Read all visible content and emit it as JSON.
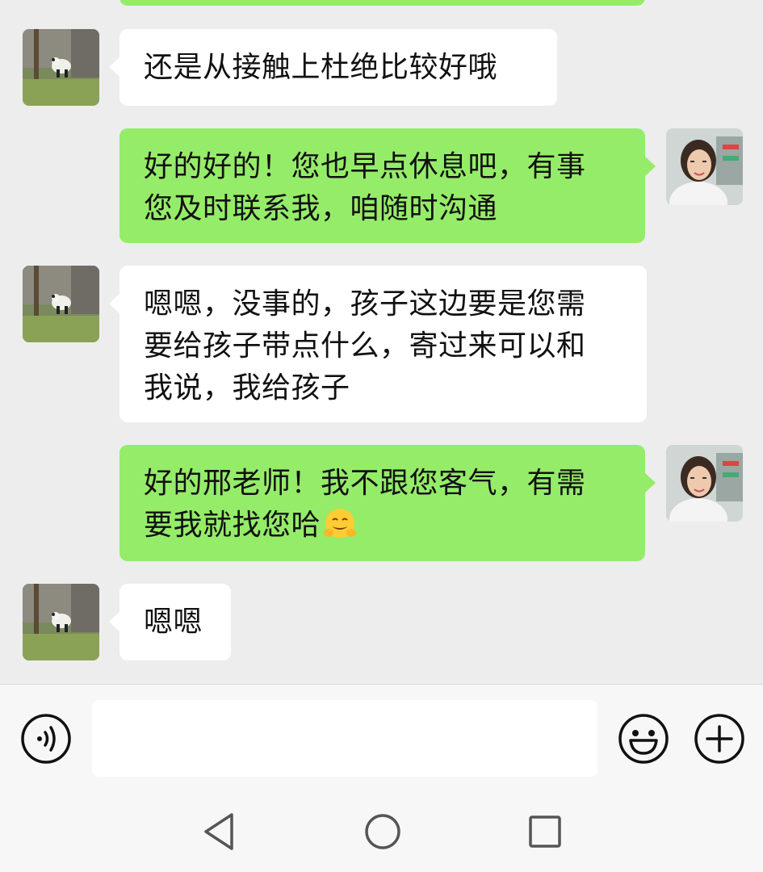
{
  "messages": [
    {
      "side": "in",
      "lines": [
        "还是从接触上杜绝比较好哦"
      ]
    },
    {
      "side": "out",
      "lines": [
        "好的好的！您也早点休息吧，有事",
        "您及时联系我，咱随时沟通"
      ]
    },
    {
      "side": "in",
      "lines": [
        "嗯嗯，没事的，孩子这边要是您需",
        "要给孩子带点什么，寄过来可以和",
        "我说，我给孩子"
      ]
    },
    {
      "side": "out",
      "lines": [
        "好的邢老师！我不跟您客气，有需",
        "要我就找您哈"
      ],
      "emoji": "hugging-face-emoji"
    },
    {
      "side": "in",
      "lines": [
        "嗯嗯"
      ]
    }
  ],
  "input": {
    "placeholder": "",
    "value": ""
  },
  "icons": {
    "voice": "voice-icon",
    "emoji": "emoji-smile-icon",
    "more": "plus-icon",
    "back": "nav-back-icon",
    "home": "nav-home-icon",
    "recents": "nav-recents-icon"
  },
  "colors": {
    "background": "#ededed",
    "outgoing_bubble": "#95ec69",
    "incoming_bubble": "#ffffff",
    "bar": "#f7f7f7"
  }
}
